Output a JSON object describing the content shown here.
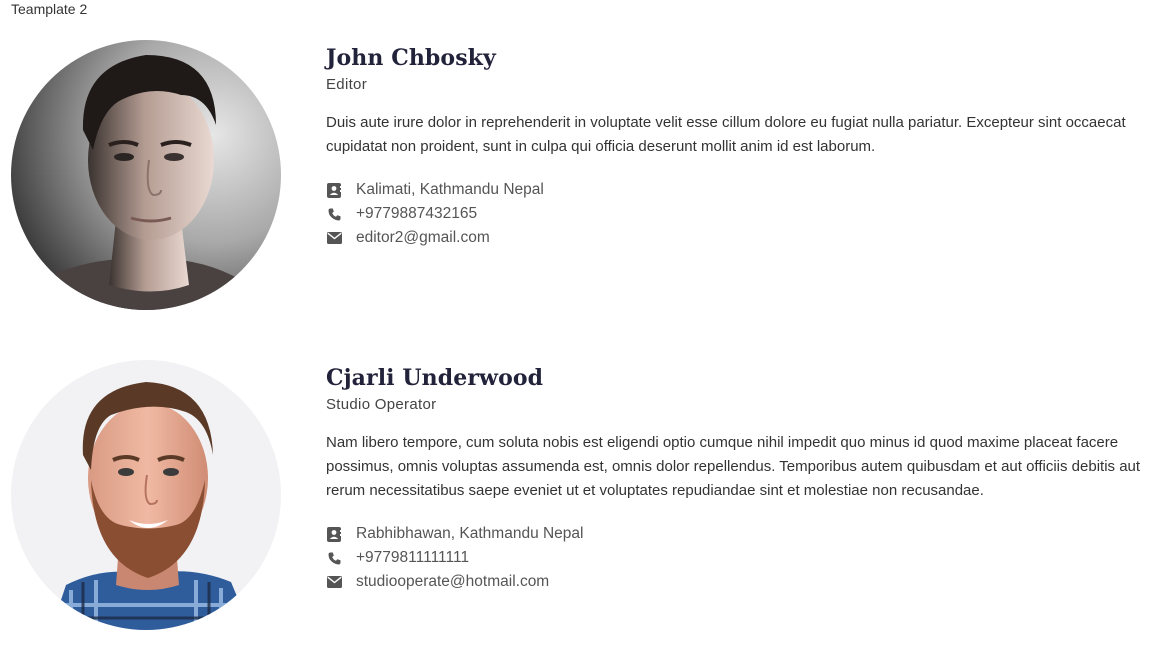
{
  "page": {
    "label": "Teamplate 2"
  },
  "members": [
    {
      "name": "John Chbosky",
      "role": "Editor",
      "bio": "Duis aute irure dolor in reprehenderit in voluptate velit esse cillum dolore eu fugiat nulla pariatur. Excepteur sint occaecat cupidatat non proident, sunt in culpa qui officia deserunt mollit anim id est laborum.",
      "address": "Kalimati, Kathmandu Nepal",
      "phone": "+9779887432165",
      "email": "editor2@gmail.com"
    },
    {
      "name": "Cjarli Underwood",
      "role": "Studio Operator",
      "bio": "Nam libero tempore, cum soluta nobis est eligendi optio cumque nihil impedit quo minus id quod maxime placeat facere possimus, omnis voluptas assumenda est, omnis dolor repellendus. Temporibus autem quibusdam et aut officiis debitis aut rerum necessitatibus saepe eveniet ut et voluptates repudiandae sint et molestiae non recusandae.",
      "address": "Rabhibhawan, Kathmandu Nepal",
      "phone": "+9779811111111",
      "email": "studiooperate@hotmail.com"
    }
  ],
  "icons": {
    "address": "address-card-icon",
    "phone": "phone-icon",
    "email": "envelope-icon"
  },
  "colors": {
    "name": "#22223a",
    "icon": "#555555"
  }
}
